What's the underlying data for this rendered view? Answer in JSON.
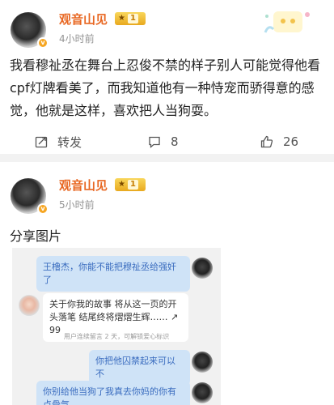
{
  "posts": [
    {
      "username": "观音山见",
      "level": "1",
      "time": "4小时前",
      "text": "我看穆祉丞在舞台上忍俊不禁的样子别人可能觉得他看cpf灯牌看美了，而我知道他有一种恃宠而骄得意的感觉，他就是这样，喜欢把人当狗耍。",
      "repost_label": "转发",
      "comment_count": "8",
      "like_count": "26"
    },
    {
      "username": "观音山见",
      "level": "1",
      "time": "5小时前",
      "text": "分享图片",
      "image": {
        "msg1": "王橹杰，你能不能把穆祉丞给强奸了",
        "msg2": "关于你我的故事 将从这一页的开头落笔 结尾终将熠熠生辉……",
        "msg2_suffix": "↗ 99",
        "notice": "用户连续留言 2 天，可解锁爱心标识",
        "msg3": "你把他囚禁起来可以不",
        "msg4": "你别给他当狗了我真去你妈的你有点骨气"
      }
    }
  ],
  "colors": {
    "username": "#e86722",
    "meta": "#939393",
    "bubble_right": "#cfe3f7",
    "bubble_right_text": "#3a6cbf"
  }
}
